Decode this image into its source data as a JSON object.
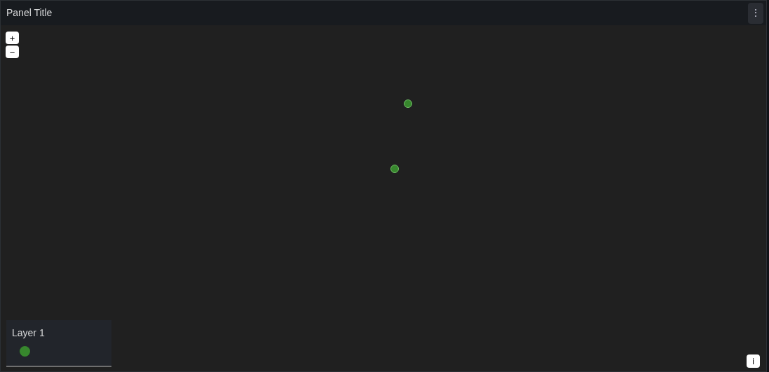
{
  "panel": {
    "title": "Panel Title",
    "menu_icon": "⋮"
  },
  "map": {
    "zoom_in": "+",
    "zoom_out": "−",
    "info": "i"
  },
  "legend": {
    "layers": [
      {
        "name": "Layer 1",
        "color": "#37872d"
      }
    ]
  }
}
